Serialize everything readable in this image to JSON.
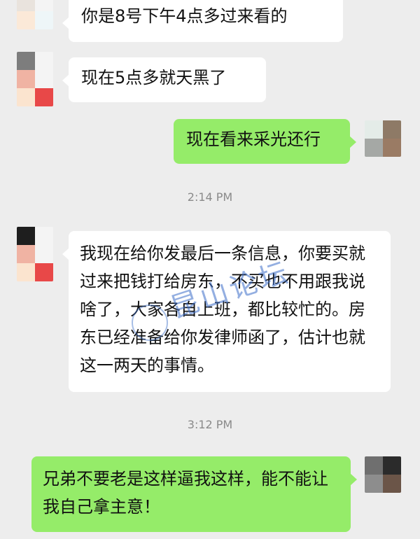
{
  "messages": [
    {
      "side": "left",
      "text": "你是8号下午4点多过来看的"
    },
    {
      "side": "left",
      "text": "现在5点多就天黑了"
    },
    {
      "side": "right",
      "text": "现在看来采光还行"
    },
    {
      "side": "left",
      "text": "我现在给你发最后一条信息，你要买就过来把钱打给房东，不买也不用跟我说啥了，大家各自上班，都比较忙的。房东已经准备给你发律师函了，估计也就这一两天的事情。"
    },
    {
      "side": "right",
      "text": "兄弟不要老是这样逼我这样，能不能让我自己拿主意！"
    }
  ],
  "timestamps": [
    "2:14 PM",
    "3:12 PM"
  ],
  "watermark": "昆山论坛",
  "colors": {
    "background": "#ededed",
    "bubble_other": "#ffffff",
    "bubble_me": "#95ec69",
    "timestamp": "#8a8a8a"
  },
  "icons": {
    "avatar_other": "avatar-other-icon",
    "avatar_me": "avatar-me-icon",
    "watermark_logo": "watermark-logo-icon"
  }
}
